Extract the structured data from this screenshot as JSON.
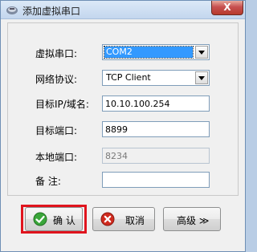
{
  "window": {
    "title": "添加虚拟串口",
    "close_glyph": "X"
  },
  "form": {
    "serial_port": {
      "label": "虚拟串口:",
      "value": "COM2"
    },
    "protocol": {
      "label": "网络协议:",
      "value": "TCP Client"
    },
    "target_ip": {
      "label": "目标IP/域名:",
      "value": "10.10.100.254"
    },
    "target_port": {
      "label": "目标端口:",
      "value": "8899"
    },
    "local_port": {
      "label": "本地端口:",
      "value": "8234"
    },
    "note": {
      "label": "备  注:",
      "value": ""
    }
  },
  "buttons": {
    "ok": "确 认",
    "cancel": "取消",
    "advanced": "高级 ≫"
  },
  "colors": {
    "highlight": "#e0141e",
    "selection": "#3399ff",
    "ok_icon": "#3aa63a",
    "cancel_icon": "#d02a1e"
  }
}
